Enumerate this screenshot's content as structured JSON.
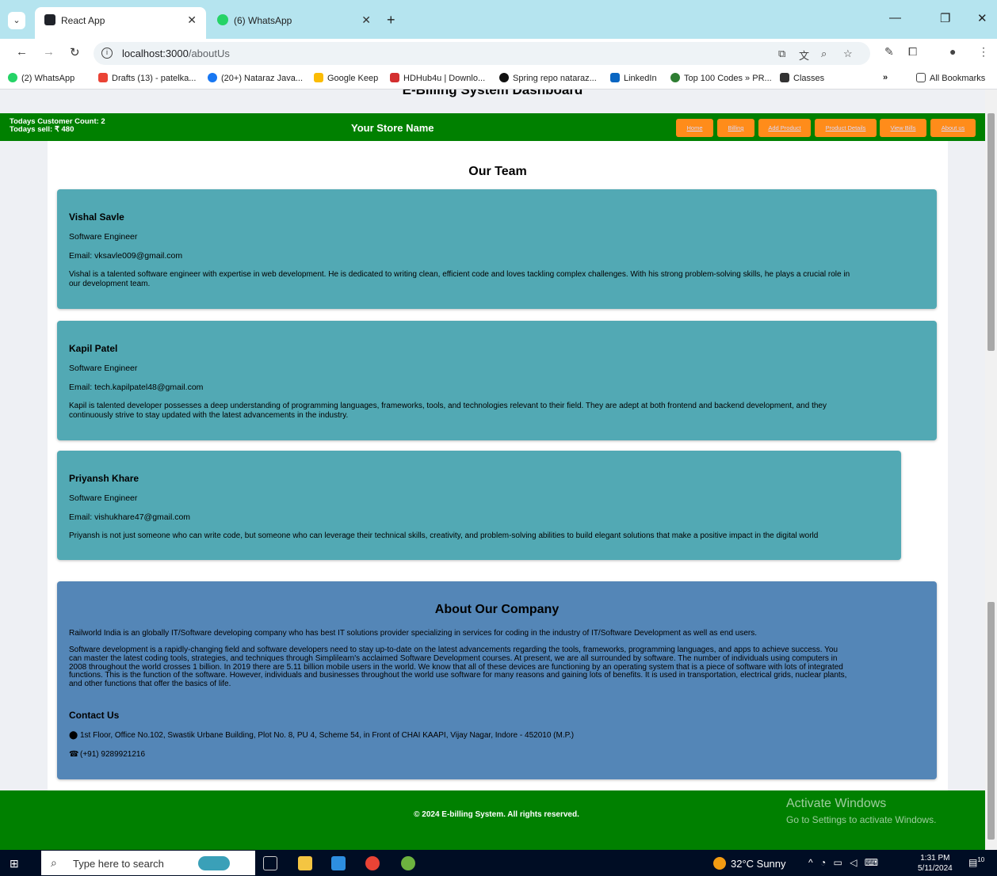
{
  "browser": {
    "tabs": [
      {
        "title": "React App",
        "active": true
      },
      {
        "title": "(6) WhatsApp",
        "active": false
      }
    ],
    "url_host": "localhost:3000",
    "url_path": "/aboutUs",
    "bookmarks": [
      "(2) WhatsApp",
      "Drafts (13) - patelka...",
      "(20+) Nataraz Java...",
      "Google Keep",
      "HDHub4u | Downlo...",
      "Spring repo nataraz...",
      "LinkedIn",
      "Top 100 Codes » PR...",
      "Classes"
    ],
    "all_bookmarks": "All Bookmarks",
    "more": "»"
  },
  "header": {
    "dashboard_title": "E-Billing System Dashboard",
    "customer_count": "Todays Customer Count: 2",
    "todays_sell": "Todays sell: ₹ 480",
    "store_name": "Your Store Name",
    "nav": [
      "Home",
      "Billing",
      "Add Product",
      "Product Details",
      "View Bills",
      "About us"
    ]
  },
  "team": {
    "title": "Our Team",
    "members": [
      {
        "name": "Vishal Savle",
        "role": "Software Engineer",
        "email": "Email: vksavle009@gmail.com",
        "bio_1": "Vishal is a talented software engineer with expertise in web development. He is dedicated to writing clean, efficient code and loves tackling complex challenges. With his strong problem-solving skills, he plays a crucial role in",
        "bio_2": "our development team."
      },
      {
        "name": "Kapil Patel",
        "role": "Software Engineer",
        "email": "Email: tech.kapilpatel48@gmail.com",
        "bio_1": "Kapil is talented developer possesses a deep understanding of programming languages, frameworks, tools, and technologies relevant to their field. They are adept at both frontend and backend development, and they",
        "bio_2": "continuously strive to stay updated with the latest advancements in the industry."
      },
      {
        "name": "Priyansh Khare",
        "role": "Software Engineer",
        "email": "Email: vishukhare47@gmail.com",
        "bio_1": "Priyansh is not just someone who can write code, but someone who can leverage their technical skills, creativity, and problem-solving abilities to build elegant solutions that make a positive impact in the digital world",
        "bio_2": ""
      }
    ]
  },
  "company": {
    "title": "About Our Company",
    "p1": "Railworld India is an globally IT/Software developing company who has best IT solutions provider specializing in services for coding in the industry of IT/Software Development as well as end users.",
    "p2_lines": [
      "Software development is a rapidly-changing field and software developers need to stay up-to-date on the latest advancements regarding the tools, frameworks, programming languages, and apps to achieve success. You",
      "can master the latest coding tools, strategies, and techniques through Simplilearn's acclaimed Software Development courses. At present, we are all surrounded by software. The number of individuals using computers in",
      "2008 throughout the world crosses 1 billion. In 2019 there are 5.11 billion mobile users in the world. We know that all of these devices are functioning by an operating system that is a piece of software with lots of integrated",
      "functions. This is the function of the software. However, individuals and businesses throughout the world use software for many reasons and gaining lots of benefits. It is used in transportation, electrical grids, nuclear plants,",
      "and other functions that offer the basics of life."
    ],
    "contact_title": "Contact Us",
    "address": "1st Floor, Office No.102, Swastik Urbane Building, Plot No. 8, PU 4, Scheme 54, in Front of CHAI KAAPI, Vijay Nagar, Indore - 452010 (M.P.)",
    "phone": "(+91) 9289921216"
  },
  "footer": {
    "text": "© 2024 E-billing System. All rights reserved.",
    "activate_1": "Activate Windows",
    "activate_2": "Go to Settings to activate Windows."
  },
  "taskbar": {
    "search_placeholder": "Type here to search",
    "weather": "32°C  Sunny",
    "time": "1:31 PM",
    "date": "5/11/2024",
    "notifications": "10"
  }
}
